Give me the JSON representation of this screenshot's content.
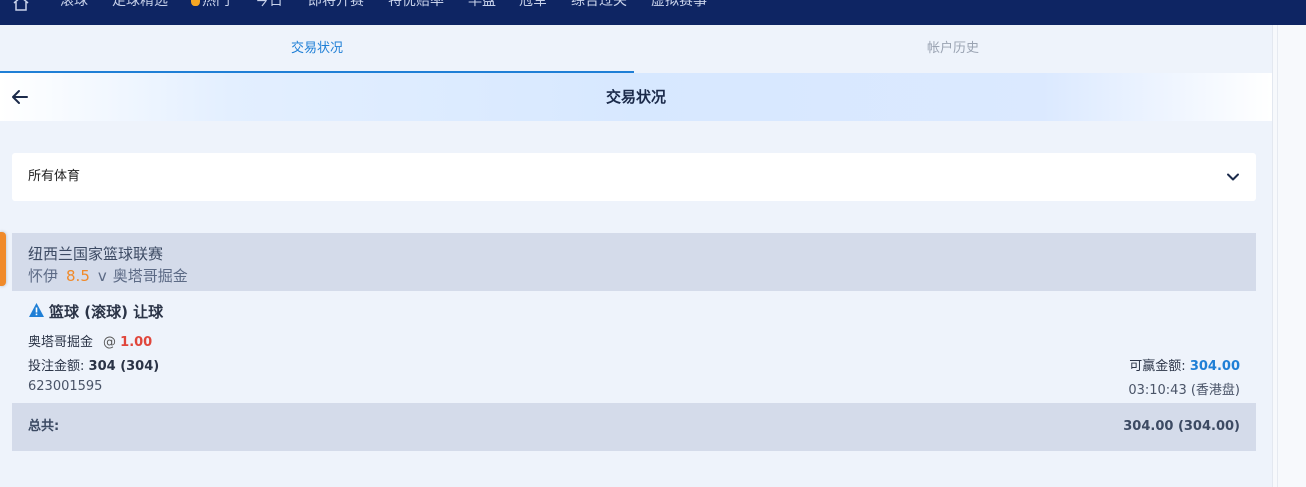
{
  "nav": {
    "items": [
      {
        "label": "滚球"
      },
      {
        "label": "足球精选"
      },
      {
        "label": "热门",
        "icon": "flame-icon"
      },
      {
        "label": "今日"
      },
      {
        "label": "即将开赛"
      },
      {
        "label": "特优赔率"
      },
      {
        "label": "早盘"
      },
      {
        "label": "冠军"
      },
      {
        "label": "综合过关"
      },
      {
        "label": "虚拟赛事"
      }
    ]
  },
  "tabs": [
    {
      "label": "交易状况",
      "active": true
    },
    {
      "label": "帐户历史",
      "active": false
    }
  ],
  "header": {
    "title": "交易状况"
  },
  "filter": {
    "selected": "所有体育"
  },
  "bet": {
    "league": "纽西兰国家篮球联赛",
    "home": "怀伊",
    "handicap": "8.5",
    "vs": "v",
    "away": "奥塔哥掘金",
    "market": "篮球 (滚球) 让球",
    "selection": "奥塔哥掘金",
    "at": "@",
    "odds": "1.00",
    "stake_label": "投注金额:",
    "stake_value": "304 (304)",
    "payout_label": "可赢金额:",
    "payout_value": "304.00",
    "ref": "623001595",
    "time": "03:10:43 (香港盘)"
  },
  "total": {
    "label": "总共:",
    "value": "304.00 (304.00)"
  },
  "colors": {
    "nav_bg": "#0e2563",
    "accent": "#1f7fd6",
    "odds": "#e0463b",
    "handicap": "#f08a2a"
  }
}
